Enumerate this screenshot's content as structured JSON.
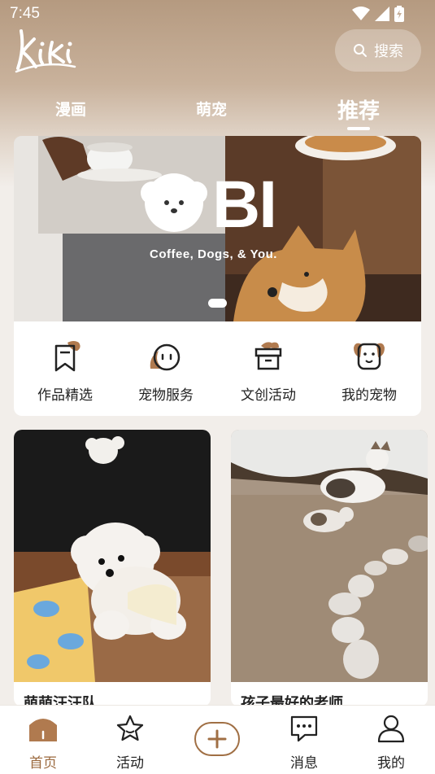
{
  "status_bar": {
    "time": "7:45"
  },
  "header": {
    "logo_text": "kiki",
    "search_label": "搜索"
  },
  "tabs": [
    {
      "label": "漫画"
    },
    {
      "label": "萌宠"
    },
    {
      "label": "推荐"
    }
  ],
  "active_tab": "推荐",
  "banner": {
    "brand": "BI",
    "tagline": "Coffee, Dogs, & You.",
    "page_count": 1,
    "current_page": 1
  },
  "quick_links": [
    {
      "label": "作品精选",
      "icon": "bookmark-icon"
    },
    {
      "label": "宠物服务",
      "icon": "pet-face-icon"
    },
    {
      "label": "文创活动",
      "icon": "gift-box-icon"
    },
    {
      "label": "我的宠物",
      "icon": "dog-face-icon"
    }
  ],
  "posts": [
    {
      "title": "萌萌汪汪队"
    },
    {
      "title": "孩子最好的老师"
    }
  ],
  "bottom_nav": [
    {
      "label": "首页",
      "icon": "home-icon",
      "active": true
    },
    {
      "label": "活动",
      "icon": "star-icon",
      "active": false
    },
    {
      "label": "",
      "icon": "add-icon",
      "active": false
    },
    {
      "label": "消息",
      "icon": "message-icon",
      "active": false
    },
    {
      "label": "我的",
      "icon": "profile-icon",
      "active": false
    }
  ],
  "colors": {
    "accent": "#9b6a3f",
    "header_gradient_top": "#b59a80",
    "background": "#f2eeea"
  }
}
